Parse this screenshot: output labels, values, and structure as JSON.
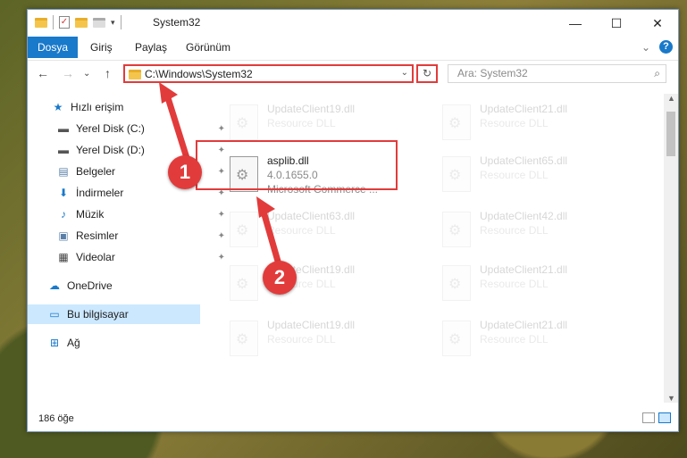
{
  "window": {
    "title": "System32",
    "controls": {
      "minimize": "—",
      "maximize": "☐",
      "close": "✕"
    }
  },
  "ribbon": {
    "tabs": [
      "Dosya",
      "Giriş",
      "Paylaş",
      "Görünüm"
    ],
    "collapse": "⌄",
    "help": "?"
  },
  "address": {
    "path": "C:\\Windows\\System32",
    "refresh": "↻",
    "search_placeholder": "Ara: System32",
    "search_icon": "search-icon"
  },
  "nav_buttons": {
    "back": "←",
    "forward": "→",
    "recent": "⌄",
    "up": "↑"
  },
  "sidebar": {
    "items": [
      {
        "label": "Hızlı erişim",
        "icon": "star-icon",
        "glyph": "★",
        "color": "#1979ca",
        "pinned": false
      },
      {
        "label": "Yerel Disk (C:)",
        "icon": "drive-icon",
        "glyph": "▬",
        "color": "#555555",
        "pinned": true
      },
      {
        "label": "Yerel Disk (D:)",
        "icon": "drive-icon",
        "glyph": "▬",
        "color": "#555555",
        "pinned": true
      },
      {
        "label": "Belgeler",
        "icon": "documents-icon",
        "glyph": "▤",
        "color": "#5a7fa8",
        "pinned": true
      },
      {
        "label": "İndirmeler",
        "icon": "download-icon",
        "glyph": "⬇",
        "color": "#1979ca",
        "pinned": true
      },
      {
        "label": "Müzik",
        "icon": "music-icon",
        "glyph": "♪",
        "color": "#1979ca",
        "pinned": true
      },
      {
        "label": "Resimler",
        "icon": "pictures-icon",
        "glyph": "▣",
        "color": "#5a7fa8",
        "pinned": true
      },
      {
        "label": "Videolar",
        "icon": "video-icon",
        "glyph": "▦",
        "color": "#444444",
        "pinned": true
      },
      {
        "label": "OneDrive",
        "icon": "cloud-icon",
        "glyph": "☁",
        "color": "#1979ca",
        "pinned": false
      },
      {
        "label": "Bu bilgisayar",
        "icon": "computer-icon",
        "glyph": "▭",
        "color": "#1979ca",
        "pinned": false,
        "selected": true
      },
      {
        "label": "Ağ",
        "icon": "network-icon",
        "glyph": "⊞",
        "color": "#1979ca",
        "pinned": false
      }
    ],
    "pin_glyph": "📌"
  },
  "files": {
    "highlighted": {
      "name": "asplib.dll",
      "version": "4.0.1655.0",
      "description": "Microsoft Commerce ..."
    },
    "faded": [
      {
        "name": "UpdateClient19.dll",
        "type": "Resource DLL"
      },
      {
        "name": "UpdateClient21.dll",
        "type": "Resource DLL"
      },
      {
        "name": "UpdateClient65.dll",
        "type": "Resource DLL"
      },
      {
        "name": "UpdateClient63.dll",
        "type": "Resource DLL"
      },
      {
        "name": "UpdateClient42.dll",
        "type": "Resource DLL"
      },
      {
        "name": "UpdateClient19.dll",
        "type": "Resource DLL"
      },
      {
        "name": "UpdateClient21.dll",
        "type": "Resource DLL"
      },
      {
        "name": "UpdateClient19.dll",
        "type": "Resource DLL"
      },
      {
        "name": "UpdateClient21.dll",
        "type": "Resource DLL"
      }
    ]
  },
  "status": {
    "count": "186 öğe"
  },
  "annotations": [
    {
      "number": "1",
      "color": "#e23b3b"
    },
    {
      "number": "2",
      "color": "#e23b3b"
    }
  ]
}
